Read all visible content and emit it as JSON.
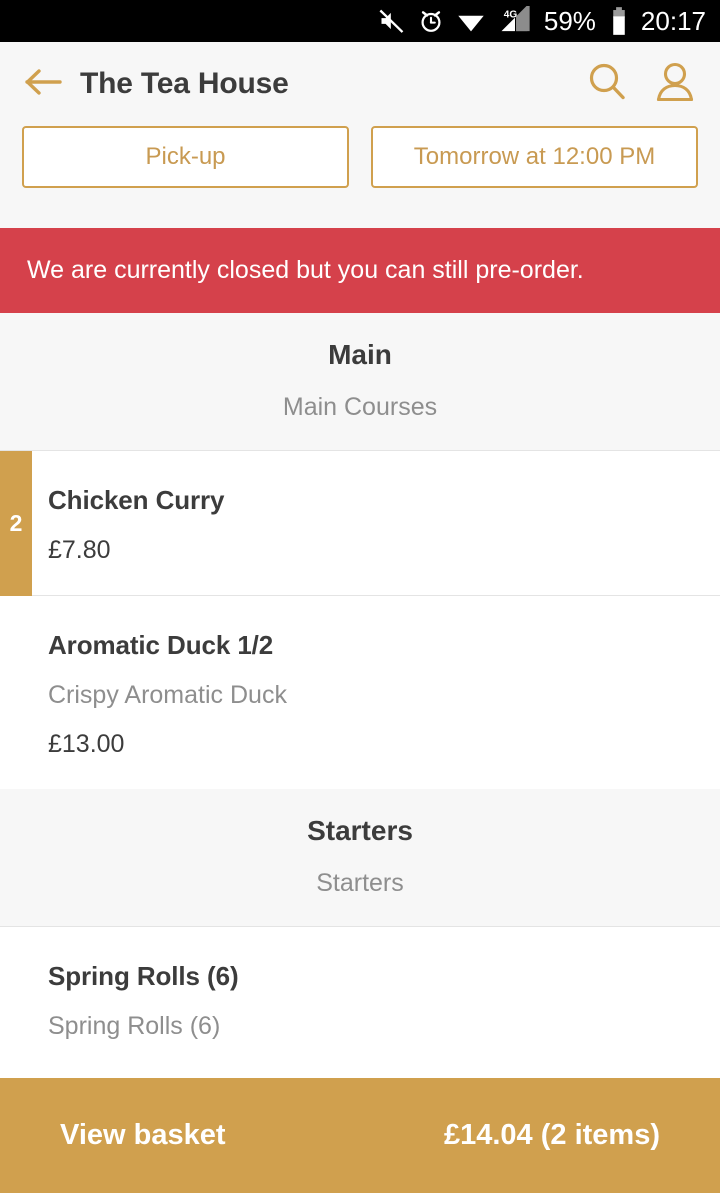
{
  "status_bar": {
    "icons": [
      "mute-icon",
      "alarm-icon",
      "wifi-icon",
      "signal-4g-icon"
    ],
    "network_label": "4G",
    "battery_percent": "59%",
    "time": "20:17"
  },
  "header": {
    "back_icon": "back-arrow-icon",
    "title": "The Tea House",
    "search_icon": "search-icon",
    "account_icon": "account-icon"
  },
  "order_options": {
    "fulfilment": "Pick-up",
    "schedule": "Tomorrow at 12:00 PM"
  },
  "alert": {
    "message": "We are currently closed but you can still pre-order.",
    "color": "#d5414b"
  },
  "sections": [
    {
      "title": "Main",
      "subtitle": "Main Courses",
      "items": [
        {
          "quantity": "2",
          "name": "Chicken Curry",
          "description": "",
          "price": "£7.80"
        },
        {
          "quantity": "",
          "name": "Aromatic Duck 1/2",
          "description": "Crispy Aromatic Duck",
          "price": "£13.00"
        }
      ]
    },
    {
      "title": "Starters",
      "subtitle": "Starters",
      "items": [
        {
          "quantity": "",
          "name": "Spring Rolls (6)",
          "description": "Spring Rolls (6)",
          "price": ""
        }
      ]
    }
  ],
  "basket": {
    "label": "View basket",
    "total": "£14.04 (2 items)",
    "color": "#d0a04e"
  },
  "theme": {
    "accent": "#d0a04e",
    "accent_text": "#c89a52",
    "danger": "#d5414b",
    "text_dark": "#3c3c3c",
    "text_muted": "#8e8e8e",
    "surface": "#f7f7f7"
  }
}
